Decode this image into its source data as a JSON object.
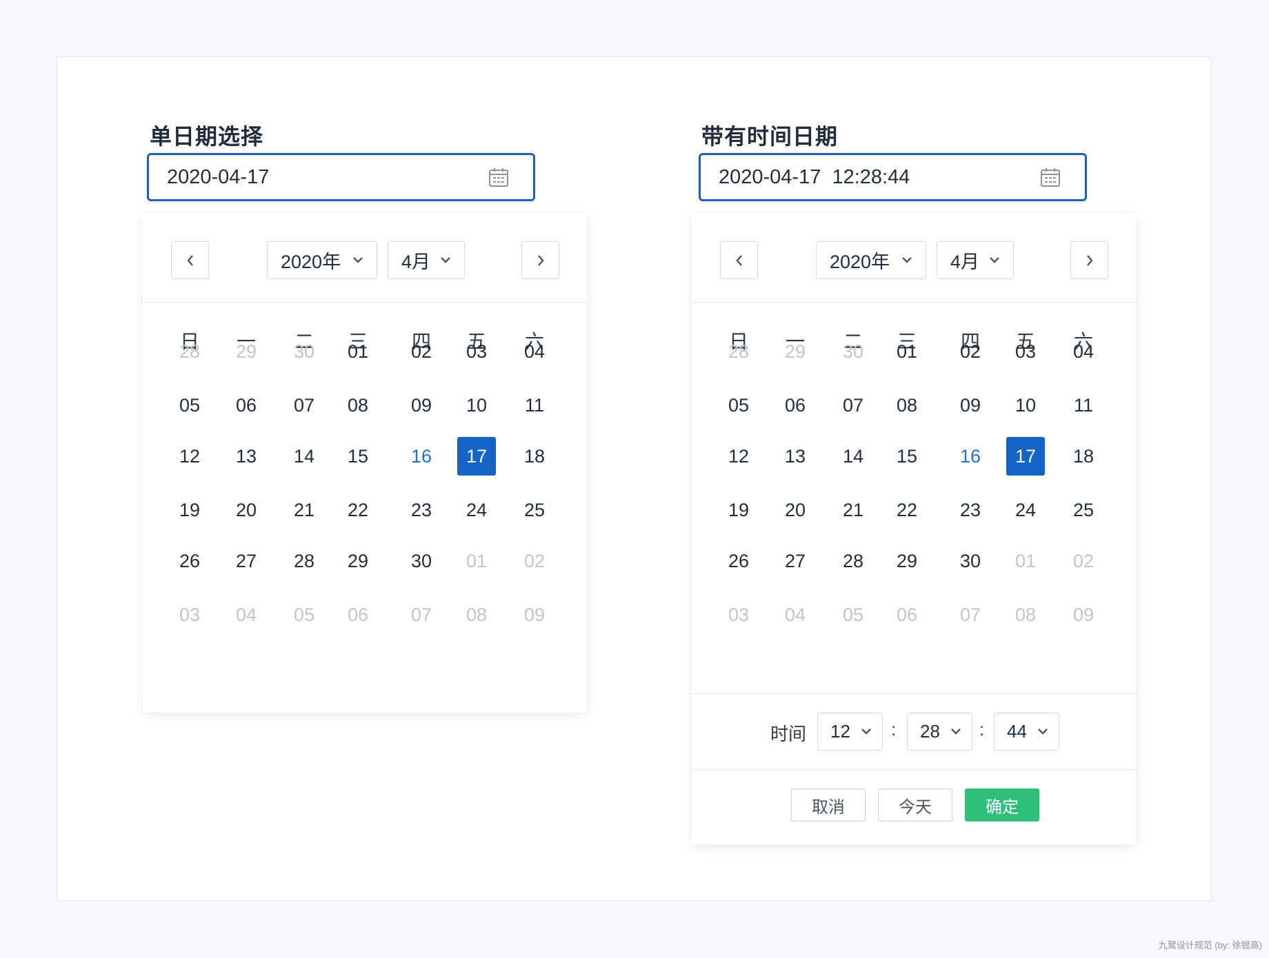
{
  "single": {
    "title": "单日期选择",
    "value": "2020-04-17",
    "year_label": "2020年",
    "month_label": "4月"
  },
  "datetime": {
    "title": "带有时间日期",
    "value": "2020-04-17  12:28:44",
    "year_label": "2020年",
    "month_label": "4月",
    "time_label": "时间",
    "hour": "12",
    "minute": "28",
    "second": "44",
    "colon": ":",
    "cancel_label": "取消",
    "today_label": "今天",
    "confirm_label": "确定"
  },
  "weekdays": [
    "日",
    "一",
    "二",
    "三",
    "四",
    "五",
    "六"
  ],
  "days": [
    [
      {
        "d": "28",
        "s": "muted"
      },
      {
        "d": "29",
        "s": "muted"
      },
      {
        "d": "30",
        "s": "muted"
      },
      {
        "d": "01",
        "s": ""
      },
      {
        "d": "02",
        "s": ""
      },
      {
        "d": "03",
        "s": ""
      },
      {
        "d": "04",
        "s": ""
      }
    ],
    [
      {
        "d": "05",
        "s": ""
      },
      {
        "d": "06",
        "s": ""
      },
      {
        "d": "07",
        "s": ""
      },
      {
        "d": "08",
        "s": ""
      },
      {
        "d": "09",
        "s": ""
      },
      {
        "d": "10",
        "s": ""
      },
      {
        "d": "11",
        "s": ""
      }
    ],
    [
      {
        "d": "12",
        "s": ""
      },
      {
        "d": "13",
        "s": ""
      },
      {
        "d": "14",
        "s": ""
      },
      {
        "d": "15",
        "s": ""
      },
      {
        "d": "16",
        "s": "today"
      },
      {
        "d": "17",
        "s": "selected"
      },
      {
        "d": "18",
        "s": ""
      }
    ],
    [
      {
        "d": "19",
        "s": ""
      },
      {
        "d": "20",
        "s": ""
      },
      {
        "d": "21",
        "s": ""
      },
      {
        "d": "22",
        "s": ""
      },
      {
        "d": "23",
        "s": ""
      },
      {
        "d": "24",
        "s": ""
      },
      {
        "d": "25",
        "s": ""
      }
    ],
    [
      {
        "d": "26",
        "s": ""
      },
      {
        "d": "27",
        "s": ""
      },
      {
        "d": "28",
        "s": ""
      },
      {
        "d": "29",
        "s": ""
      },
      {
        "d": "30",
        "s": ""
      },
      {
        "d": "01",
        "s": "muted"
      },
      {
        "d": "02",
        "s": "muted"
      }
    ],
    [
      {
        "d": "03",
        "s": "muted"
      },
      {
        "d": "04",
        "s": "muted"
      },
      {
        "d": "05",
        "s": "muted"
      },
      {
        "d": "06",
        "s": "muted"
      },
      {
        "d": "07",
        "s": "muted"
      },
      {
        "d": "08",
        "s": "muted"
      },
      {
        "d": "09",
        "s": "muted"
      }
    ]
  ],
  "colors": {
    "accent": "#1565c8",
    "input_border": "#1f5fbf",
    "confirm": "#2ebf7d",
    "muted": "#c0c4cc"
  },
  "icons": {
    "input": "calendar-icon",
    "prev": "chevron-left-icon",
    "next": "chevron-right-icon",
    "dropdown": "chevron-down-icon"
  },
  "credit": "九鹭设计规范 (by: 徐银高)"
}
